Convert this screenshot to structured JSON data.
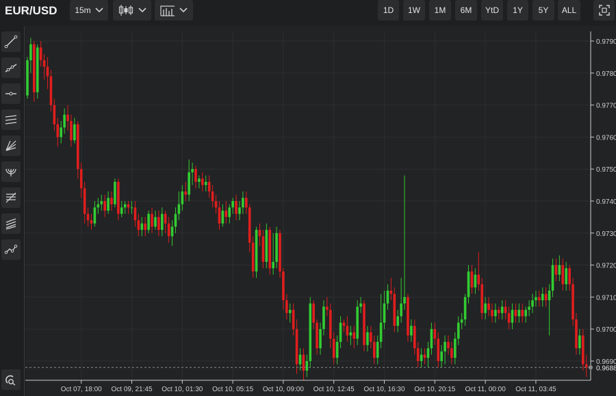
{
  "toolbar": {
    "symbol": "EUR/USD",
    "interval": "15m",
    "chart_type_icon": "candlestick-icon",
    "indicators_icon": "indicators-icon",
    "ranges": [
      "1D",
      "1W",
      "1M",
      "6M",
      "YtD",
      "1Y",
      "5Y",
      "ALL"
    ],
    "fullscreen_icon": "fullscreen-icon"
  },
  "left_tools": [
    "trend-line-icon",
    "ray-icon",
    "horizontal-line-icon",
    "parallel-channel-icon",
    "fib-fan-icon",
    "fib-arcs-icon",
    "fib-retracement-icon",
    "pitchfork-icon",
    "path-icon",
    "magnet-icon"
  ],
  "colors": {
    "up": "#33cc33",
    "down": "#e01e1e",
    "background": "#222324",
    "grid": "#2d2f31",
    "axis": "#cfcfcf"
  },
  "chart_data": {
    "type": "candlestick",
    "ylim": [
      0.9684,
      0.9793
    ],
    "y_ticks": [
      "0.9790",
      "0.9780",
      "0.9770",
      "0.9760",
      "0.9750",
      "0.9740",
      "0.9730",
      "0.9720",
      "0.9710",
      "0.9700",
      "0.9690"
    ],
    "last_price": "0.9688",
    "x_ticks": [
      "Oct 07, 18:00",
      "Oct 09, 21:45",
      "Oct 10, 01:30",
      "Oct 10, 05:15",
      "Oct 10, 09:00",
      "Oct 10, 12:45",
      "Oct 10, 16:30",
      "Oct 10, 20:15",
      "Oct 11, 00:00",
      "Oct 11, 03:45"
    ],
    "x_tick_index": [
      16,
      31,
      46,
      61,
      76,
      91,
      106,
      121,
      136,
      151
    ],
    "candles": [
      [
        0.9773,
        0.9784,
        0.9772,
        0.9785
      ],
      [
        0.9784,
        0.9789,
        0.978,
        0.9791
      ],
      [
        0.9789,
        0.9774,
        0.9771,
        0.979
      ],
      [
        0.9774,
        0.9788,
        0.9772,
        0.9789
      ],
      [
        0.9788,
        0.9784,
        0.9782,
        0.979
      ],
      [
        0.9784,
        0.9782,
        0.9778,
        0.9786
      ],
      [
        0.9782,
        0.9779,
        0.9775,
        0.9785
      ],
      [
        0.9779,
        0.977,
        0.9768,
        0.9781
      ],
      [
        0.977,
        0.9764,
        0.9762,
        0.9772
      ],
      [
        0.9764,
        0.976,
        0.9757,
        0.9766
      ],
      [
        0.976,
        0.9763,
        0.9758,
        0.9765
      ],
      [
        0.9763,
        0.9767,
        0.9761,
        0.9769
      ],
      [
        0.9767,
        0.9765,
        0.9762,
        0.977
      ],
      [
        0.9765,
        0.9759,
        0.9757,
        0.9767
      ],
      [
        0.9759,
        0.9764,
        0.9758,
        0.9766
      ],
      [
        0.9764,
        0.975,
        0.9747,
        0.9765
      ],
      [
        0.975,
        0.9744,
        0.9741,
        0.9752
      ],
      [
        0.9744,
        0.9736,
        0.9733,
        0.9746
      ],
      [
        0.9736,
        0.9734,
        0.9732,
        0.9738
      ],
      [
        0.9734,
        0.9733,
        0.9731,
        0.9736
      ],
      [
        0.9733,
        0.9738,
        0.9732,
        0.974
      ],
      [
        0.9738,
        0.9739,
        0.9736,
        0.9741
      ],
      [
        0.9739,
        0.974,
        0.9737,
        0.9742
      ],
      [
        0.974,
        0.9737,
        0.9735,
        0.9742
      ],
      [
        0.9737,
        0.9741,
        0.9736,
        0.9743
      ],
      [
        0.9741,
        0.9739,
        0.9737,
        0.9743
      ],
      [
        0.9739,
        0.9746,
        0.9738,
        0.9747
      ],
      [
        0.9746,
        0.9736,
        0.9734,
        0.9747
      ],
      [
        0.9736,
        0.9738,
        0.9735,
        0.974
      ],
      [
        0.9738,
        0.9739,
        0.9736,
        0.974
      ],
      [
        0.9739,
        0.9738,
        0.9736,
        0.974
      ],
      [
        0.9738,
        0.9738,
        0.9736,
        0.974
      ],
      [
        0.9738,
        0.9734,
        0.9732,
        0.974
      ],
      [
        0.9734,
        0.9731,
        0.9729,
        0.9736
      ],
      [
        0.9731,
        0.9733,
        0.9729,
        0.9735
      ],
      [
        0.9733,
        0.9731,
        0.9729,
        0.9735
      ],
      [
        0.9731,
        0.9736,
        0.973,
        0.9737
      ],
      [
        0.9736,
        0.9732,
        0.973,
        0.9738
      ],
      [
        0.9732,
        0.9735,
        0.9731,
        0.9737
      ],
      [
        0.9735,
        0.9731,
        0.9729,
        0.9737
      ],
      [
        0.9731,
        0.9736,
        0.9729,
        0.9738
      ],
      [
        0.9736,
        0.9733,
        0.973,
        0.9737
      ],
      [
        0.9733,
        0.9729,
        0.9727,
        0.9735
      ],
      [
        0.9729,
        0.9732,
        0.9726,
        0.9734
      ],
      [
        0.9732,
        0.9736,
        0.973,
        0.9738
      ],
      [
        0.9736,
        0.9739,
        0.9734,
        0.9743
      ],
      [
        0.9739,
        0.9743,
        0.9737,
        0.9745
      ],
      [
        0.9743,
        0.9742,
        0.974,
        0.9746
      ],
      [
        0.9742,
        0.9749,
        0.974,
        0.9753
      ],
      [
        0.9749,
        0.975,
        0.9745,
        0.9752
      ],
      [
        0.975,
        0.9746,
        0.9744,
        0.9751
      ],
      [
        0.9746,
        0.9747,
        0.9744,
        0.9748
      ],
      [
        0.9747,
        0.9745,
        0.9743,
        0.9749
      ],
      [
        0.9745,
        0.9746,
        0.9743,
        0.9748
      ],
      [
        0.9746,
        0.9743,
        0.9741,
        0.9748
      ],
      [
        0.9743,
        0.974,
        0.9738,
        0.9745
      ],
      [
        0.974,
        0.9738,
        0.9736,
        0.9742
      ],
      [
        0.9738,
        0.9733,
        0.9731,
        0.974
      ],
      [
        0.9733,
        0.9737,
        0.9732,
        0.9739
      ],
      [
        0.9737,
        0.9735,
        0.9733,
        0.974
      ],
      [
        0.9735,
        0.9738,
        0.9733,
        0.9739
      ],
      [
        0.9738,
        0.974,
        0.9736,
        0.9741
      ],
      [
        0.974,
        0.9736,
        0.9734,
        0.9742
      ],
      [
        0.9736,
        0.9738,
        0.9734,
        0.974
      ],
      [
        0.9738,
        0.9741,
        0.9736,
        0.9743
      ],
      [
        0.9741,
        0.9738,
        0.9736,
        0.9743
      ],
      [
        0.9738,
        0.9727,
        0.9724,
        0.9739
      ],
      [
        0.9727,
        0.9718,
        0.9716,
        0.9729
      ],
      [
        0.9718,
        0.9731,
        0.9716,
        0.9732
      ],
      [
        0.9731,
        0.9729,
        0.9726,
        0.9733
      ],
      [
        0.9729,
        0.9721,
        0.9719,
        0.9731
      ],
      [
        0.9721,
        0.9731,
        0.9719,
        0.9733
      ],
      [
        0.9731,
        0.9719,
        0.9717,
        0.9732
      ],
      [
        0.9719,
        0.9721,
        0.9717,
        0.973
      ],
      [
        0.9721,
        0.973,
        0.9719,
        0.9732
      ],
      [
        0.973,
        0.9718,
        0.9716,
        0.9731
      ],
      [
        0.9718,
        0.9709,
        0.9706,
        0.9719
      ],
      [
        0.9709,
        0.9705,
        0.9703,
        0.9711
      ],
      [
        0.9705,
        0.9706,
        0.9702,
        0.9708
      ],
      [
        0.9706,
        0.97,
        0.9698,
        0.9708
      ],
      [
        0.97,
        0.9689,
        0.9686,
        0.9703
      ],
      [
        0.9689,
        0.9692,
        0.9687,
        0.9694
      ],
      [
        0.9692,
        0.9687,
        0.9684,
        0.9694
      ],
      [
        0.9687,
        0.969,
        0.9685,
        0.9692
      ],
      [
        0.969,
        0.9708,
        0.9688,
        0.971
      ],
      [
        0.9708,
        0.9702,
        0.97,
        0.9709
      ],
      [
        0.9702,
        0.9694,
        0.9692,
        0.9703
      ],
      [
        0.9694,
        0.97,
        0.9692,
        0.9702
      ],
      [
        0.97,
        0.9707,
        0.9698,
        0.9709
      ],
      [
        0.9707,
        0.9706,
        0.9704,
        0.971
      ],
      [
        0.9706,
        0.9697,
        0.9694,
        0.9708
      ],
      [
        0.9697,
        0.9691,
        0.9689,
        0.9699
      ],
      [
        0.9691,
        0.9696,
        0.9689,
        0.9698
      ],
      [
        0.9696,
        0.9702,
        0.9694,
        0.9704
      ],
      [
        0.9702,
        0.9701,
        0.9699,
        0.9703
      ],
      [
        0.9701,
        0.9698,
        0.9696,
        0.9704
      ],
      [
        0.9698,
        0.9699,
        0.9695,
        0.9701
      ],
      [
        0.9699,
        0.9697,
        0.9694,
        0.9701
      ],
      [
        0.9697,
        0.9707,
        0.9695,
        0.9709
      ],
      [
        0.9707,
        0.9708,
        0.9705,
        0.971
      ],
      [
        0.9708,
        0.9695,
        0.9693,
        0.9709
      ],
      [
        0.9695,
        0.9699,
        0.9693,
        0.9701
      ],
      [
        0.9699,
        0.9696,
        0.9694,
        0.9701
      ],
      [
        0.9696,
        0.9691,
        0.9689,
        0.9698
      ],
      [
        0.9691,
        0.9696,
        0.9689,
        0.9698
      ],
      [
        0.9696,
        0.9702,
        0.9694,
        0.9711
      ],
      [
        0.9702,
        0.9708,
        0.97,
        0.9712
      ],
      [
        0.9708,
        0.9712,
        0.9706,
        0.9714
      ],
      [
        0.9712,
        0.9711,
        0.9709,
        0.9716
      ],
      [
        0.9711,
        0.9701,
        0.9699,
        0.9713
      ],
      [
        0.9701,
        0.9704,
        0.9699,
        0.9706
      ],
      [
        0.9704,
        0.9708,
        0.9702,
        0.9716
      ],
      [
        0.9708,
        0.971,
        0.9706,
        0.9748
      ],
      [
        0.971,
        0.9698,
        0.9696,
        0.9711
      ],
      [
        0.9698,
        0.9701,
        0.9696,
        0.9703
      ],
      [
        0.9701,
        0.9694,
        0.9692,
        0.9703
      ],
      [
        0.9694,
        0.969,
        0.9688,
        0.9696
      ],
      [
        0.969,
        0.9692,
        0.9688,
        0.9694
      ],
      [
        0.9692,
        0.9691,
        0.9689,
        0.9694
      ],
      [
        0.9691,
        0.9694,
        0.9688,
        0.9696
      ],
      [
        0.9694,
        0.97,
        0.9692,
        0.9702
      ],
      [
        0.97,
        0.9697,
        0.9695,
        0.9702
      ],
      [
        0.9697,
        0.969,
        0.9688,
        0.9699
      ],
      [
        0.969,
        0.9693,
        0.9688,
        0.9695
      ],
      [
        0.9693,
        0.9696,
        0.9689,
        0.9698
      ],
      [
        0.9696,
        0.9694,
        0.9692,
        0.9698
      ],
      [
        0.9694,
        0.9691,
        0.9689,
        0.9696
      ],
      [
        0.9691,
        0.9697,
        0.9689,
        0.9699
      ],
      [
        0.9697,
        0.9702,
        0.9695,
        0.9704
      ],
      [
        0.9702,
        0.9703,
        0.97,
        0.9705
      ],
      [
        0.9703,
        0.971,
        0.9701,
        0.9711
      ],
      [
        0.971,
        0.9718,
        0.9708,
        0.972
      ],
      [
        0.9718,
        0.9713,
        0.9711,
        0.972
      ],
      [
        0.9713,
        0.9717,
        0.9711,
        0.9719
      ],
      [
        0.9717,
        0.9714,
        0.9712,
        0.9724
      ],
      [
        0.9714,
        0.9705,
        0.9703,
        0.9716
      ],
      [
        0.9705,
        0.9708,
        0.9703,
        0.971
      ],
      [
        0.9708,
        0.9706,
        0.9704,
        0.971
      ],
      [
        0.9706,
        0.9704,
        0.9702,
        0.9708
      ],
      [
        0.9704,
        0.9706,
        0.9702,
        0.9708
      ],
      [
        0.9706,
        0.9705,
        0.9703,
        0.9707
      ],
      [
        0.9705,
        0.9707,
        0.9703,
        0.9709
      ],
      [
        0.9707,
        0.9705,
        0.9703,
        0.9709
      ],
      [
        0.9705,
        0.9702,
        0.97,
        0.9707
      ],
      [
        0.9702,
        0.9706,
        0.97,
        0.9708
      ],
      [
        0.9706,
        0.9704,
        0.9702,
        0.9708
      ],
      [
        0.9704,
        0.9706,
        0.9702,
        0.9708
      ],
      [
        0.9706,
        0.9704,
        0.9702,
        0.9708
      ],
      [
        0.9704,
        0.9706,
        0.9702,
        0.9707
      ],
      [
        0.9706,
        0.9707,
        0.9704,
        0.9709
      ],
      [
        0.9707,
        0.9709,
        0.9705,
        0.9711
      ],
      [
        0.9709,
        0.971,
        0.9707,
        0.9712
      ],
      [
        0.971,
        0.9709,
        0.9707,
        0.9712
      ],
      [
        0.9709,
        0.9711,
        0.9707,
        0.9713
      ],
      [
        0.9711,
        0.9709,
        0.9707,
        0.9713
      ],
      [
        0.9709,
        0.9712,
        0.9698,
        0.9714
      ],
      [
        0.9712,
        0.972,
        0.971,
        0.9722
      ],
      [
        0.972,
        0.9717,
        0.9715,
        0.9722
      ],
      [
        0.9717,
        0.972,
        0.9715,
        0.9723
      ],
      [
        0.972,
        0.9714,
        0.9712,
        0.9722
      ],
      [
        0.9714,
        0.9719,
        0.9712,
        0.9721
      ],
      [
        0.9719,
        0.9714,
        0.9712,
        0.972
      ],
      [
        0.9714,
        0.9703,
        0.9701,
        0.9716
      ],
      [
        0.9703,
        0.9694,
        0.9692,
        0.9705
      ],
      [
        0.9694,
        0.9698,
        0.9692,
        0.97
      ],
      [
        0.9698,
        0.9689,
        0.9687,
        0.97
      ],
      [
        0.9689,
        0.9688,
        0.9685,
        0.9692
      ]
    ]
  }
}
